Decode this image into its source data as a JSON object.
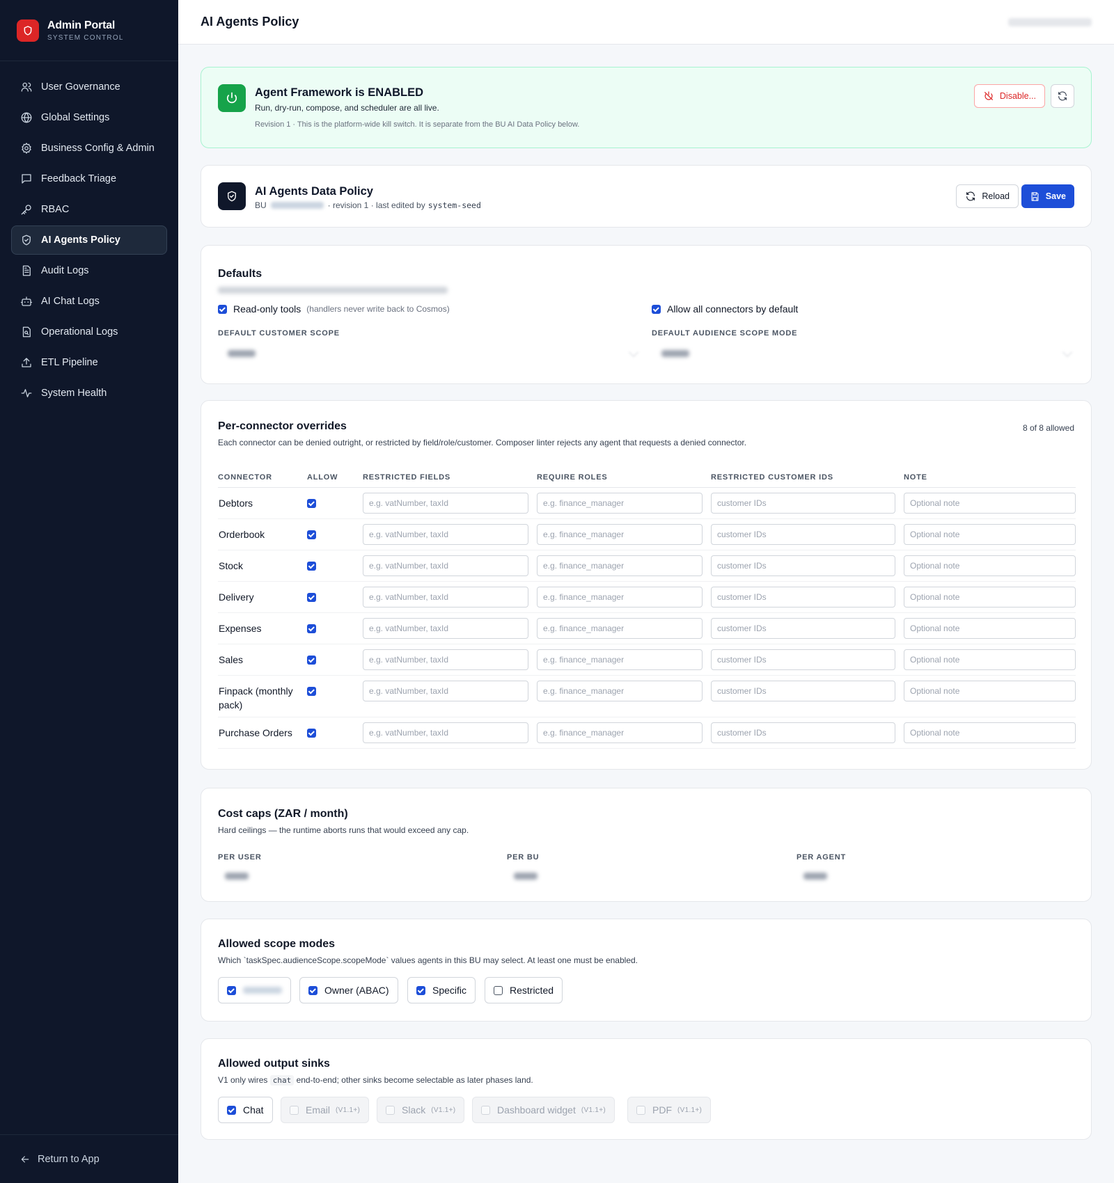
{
  "sidebar": {
    "brand_title": "Admin Portal",
    "brand_subtitle": "SYSTEM CONTROL",
    "items": [
      {
        "label": "User Governance",
        "icon": "users-icon"
      },
      {
        "label": "Global Settings",
        "icon": "globe-icon"
      },
      {
        "label": "Business Config & Admin",
        "icon": "gear-icon"
      },
      {
        "label": "Feedback Triage",
        "icon": "message-square-icon"
      },
      {
        "label": "RBAC",
        "icon": "key-icon"
      },
      {
        "label": "AI Agents Policy",
        "icon": "shield-icon",
        "active": true
      },
      {
        "label": "Audit Logs",
        "icon": "document-icon"
      },
      {
        "label": "AI Chat Logs",
        "icon": "bot-icon"
      },
      {
        "label": "Operational Logs",
        "icon": "file-search-icon"
      },
      {
        "label": "ETL Pipeline",
        "icon": "upload-icon"
      },
      {
        "label": "System Health",
        "icon": "activity-icon"
      }
    ],
    "footer_label": "Return to App"
  },
  "header": {
    "title": "AI Agents Policy"
  },
  "kill_switch": {
    "title": "Agent Framework is ENABLED",
    "description": "Run, dry-run, compose, and scheduler are all live.",
    "meta": "Revision 1 · This is the platform-wide kill switch. It is separate from the BU AI Data Policy below.",
    "disable_label": "Disable...",
    "accent": "#16a34a"
  },
  "data_policy": {
    "title": "AI Agents Data Policy",
    "bu_prefix": "BU",
    "meta_suffix": "· revision 1 · last edited by",
    "editor": "system-seed",
    "reload_label": "Reload",
    "save_label": "Save",
    "save_color": "#1d4ed8"
  },
  "defaults": {
    "title": "Defaults",
    "readonly_label": "Read-only tools",
    "readonly_hint": "(handlers never write back to Cosmos)",
    "readonly_checked": true,
    "allow_all_label": "Allow all connectors by default",
    "allow_all_checked": true,
    "customer_scope_label": "DEFAULT CUSTOMER SCOPE",
    "audience_scope_label": "DEFAULT AUDIENCE SCOPE MODE"
  },
  "connectors": {
    "title": "Per-connector overrides",
    "description": "Each connector can be denied outright, or restricted by field/role/customer. Composer linter rejects any agent that requests a denied connector.",
    "count_label": "8 of 8 allowed",
    "columns": [
      "CONNECTOR",
      "ALLOW",
      "RESTRICTED FIELDS",
      "REQUIRE ROLES",
      "RESTRICTED CUSTOMER IDS",
      "NOTE"
    ],
    "placeholders": {
      "fields": "e.g. vatNumber, taxId",
      "roles": "e.g. finance_manager",
      "customers": "customer IDs",
      "note": "Optional note"
    },
    "rows": [
      {
        "name": "Debtors",
        "allowed": true
      },
      {
        "name": "Orderbook",
        "allowed": true
      },
      {
        "name": "Stock",
        "allowed": true
      },
      {
        "name": "Delivery",
        "allowed": true
      },
      {
        "name": "Expenses",
        "allowed": true
      },
      {
        "name": "Sales",
        "allowed": true
      },
      {
        "name": "Finpack (monthly pack)",
        "allowed": true
      },
      {
        "name": "Purchase Orders",
        "allowed": true
      }
    ]
  },
  "cost_caps": {
    "title": "Cost caps (ZAR / month)",
    "description": "Hard ceilings — the runtime aborts runs that would exceed any cap.",
    "per_user_label": "PER USER",
    "per_bu_label": "PER BU",
    "per_agent_label": "PER AGENT"
  },
  "scope_modes": {
    "title": "Allowed scope modes",
    "description": "Which `taskSpec.audienceScope.scopeMode` values agents in this BU may select. At least one must be enabled.",
    "options": [
      {
        "label": "",
        "checked": true
      },
      {
        "label": "Owner (ABAC)",
        "checked": true
      },
      {
        "label": "Specific",
        "checked": true
      },
      {
        "label": "Restricted",
        "checked": false
      }
    ]
  },
  "output_sinks": {
    "title": "Allowed output sinks",
    "desc_prefix": "V1 only wires",
    "desc_code": "chat",
    "desc_suffix": "end-to-end; other sinks become selectable as later phases land.",
    "version_tag": "(V1.1+)",
    "options": [
      {
        "label": "Chat",
        "checked": true,
        "disabled": false
      },
      {
        "label": "Email",
        "checked": false,
        "disabled": true
      },
      {
        "label": "Slack",
        "checked": false,
        "disabled": true
      },
      {
        "label": "Dashboard widget",
        "checked": false,
        "disabled": true
      },
      {
        "label": "PDF",
        "checked": false,
        "disabled": true
      }
    ]
  }
}
